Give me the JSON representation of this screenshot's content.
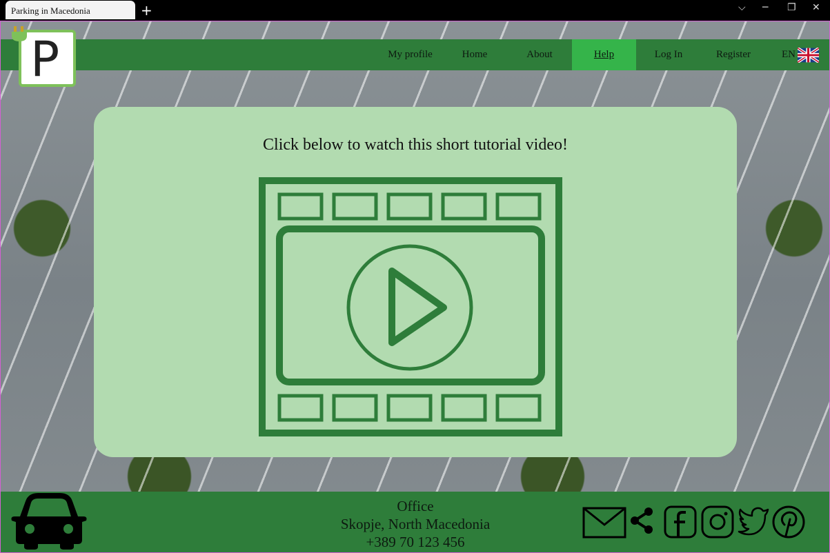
{
  "browser": {
    "tab_title": "Parking in Macedonia",
    "new_tab": "+",
    "controls": [
      "⌵",
      "─",
      "❐",
      "✕"
    ]
  },
  "nav": {
    "items": [
      {
        "label": "My profile"
      },
      {
        "label": "Home"
      },
      {
        "label": "About"
      },
      {
        "label": "Help"
      },
      {
        "label": "Log In"
      },
      {
        "label": "Register"
      },
      {
        "label": "EN"
      }
    ],
    "active": "Help"
  },
  "logo": {
    "letter": "P",
    "icon": "parking-logo-icon"
  },
  "main": {
    "heading": "Click below to watch this short tutorial video!",
    "video_icon": "video-play-icon"
  },
  "footer": {
    "office_title": "Office",
    "office_address": "Skopje, North Macedonia",
    "office_phone": "+389 70 123 456",
    "icons": [
      "car-icon",
      "mail-icon",
      "share-icon",
      "facebook-icon",
      "instagram-icon",
      "twitter-icon",
      "pinterest-icon"
    ]
  },
  "colors": {
    "nav_green": "#2e7d3a",
    "active_green": "#35b44a",
    "card_green": "#b2dbb0",
    "icon_green": "#2e7d3a"
  }
}
